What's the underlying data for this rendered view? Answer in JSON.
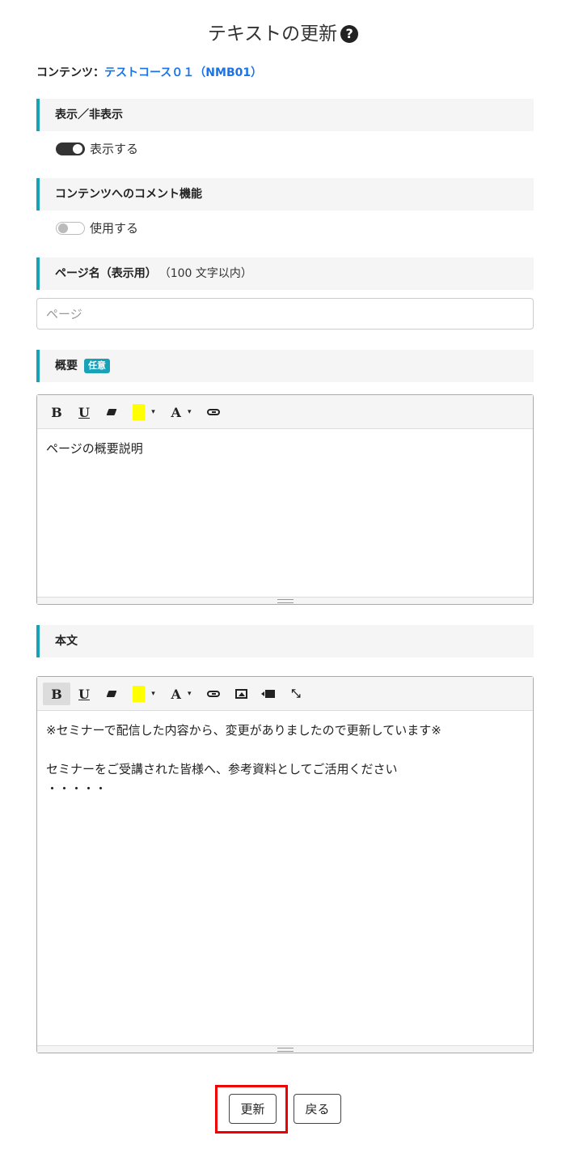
{
  "header": {
    "title": "テキストの更新",
    "help_icon": "question-circle-icon",
    "help_glyph": "?"
  },
  "content": {
    "label": "コンテンツ：",
    "link_text": "テストコース０１（NMB01）"
  },
  "visibility": {
    "heading": "表示／非表示",
    "toggle_label": "表示する",
    "checked": true
  },
  "comment_feature": {
    "heading": "コンテンツへのコメント機能",
    "toggle_label": "使用する",
    "checked": false
  },
  "page_name": {
    "heading": "ページ名（表示用）",
    "note": "（100 文字以内）",
    "placeholder": "ページ"
  },
  "summary": {
    "heading": "概要",
    "badge": "任意",
    "toolbar": [
      "bold",
      "underline",
      "eraser",
      "highlight-color",
      "font-color",
      "link"
    ],
    "bold_glyph": "B",
    "underline_glyph": "U",
    "font_glyph": "A",
    "highlight_color": "#ffff00",
    "content": "ページの概要説明"
  },
  "body": {
    "heading": "本文",
    "toolbar": [
      "bold",
      "underline",
      "eraser",
      "highlight-color",
      "font-color",
      "link",
      "image",
      "video",
      "fullscreen"
    ],
    "bold_glyph": "B",
    "underline_glyph": "U",
    "font_glyph": "A",
    "content": "※セミナーで配信した内容から、変更がありましたので更新しています※\n\nセミナーをご受講された皆様へ、参考資料としてご活用ください\n・・・・・"
  },
  "actions": {
    "update_label": "更新",
    "back_label": "戻る"
  },
  "colors": {
    "accent": "#17a2b8",
    "link": "#1a73e8",
    "highlight_box": "#e00000"
  }
}
